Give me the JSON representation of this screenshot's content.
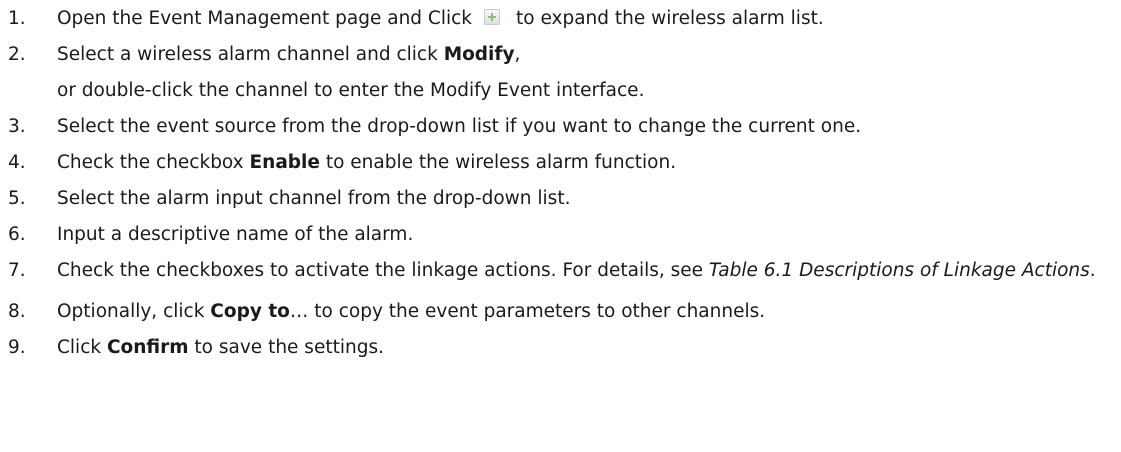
{
  "steps": [
    {
      "number": "1.",
      "before_icon": "Open the Event Management page and Click",
      "icon": "plus-icon",
      "after_icon": "to expand the wireless alarm list."
    },
    {
      "number": "2.",
      "line1_a": "Select a wireless alarm channel and click ",
      "line1_bold": "Modify",
      "line1_b": ",",
      "line2": "or double-click the channel to enter the Modify Event interface."
    },
    {
      "number": "3.",
      "text": "Select the event source from the drop-down list if you want to change the current one."
    },
    {
      "number": "4.",
      "a": "Check the checkbox ",
      "bold": "Enable",
      "b": " to enable the wireless alarm function."
    },
    {
      "number": "5.",
      "text": "Select the alarm input channel from the drop-down list."
    },
    {
      "number": "6.",
      "text": "Input a descriptive name of the alarm."
    },
    {
      "number": "7.",
      "a": "Check the checkboxes to activate the linkage actions. For details, see ",
      "italic": "Table 6.1 Descriptions of Linkage Actions",
      "b": "."
    },
    {
      "number": "8.",
      "a": "Optionally, click ",
      "bold": "Copy to",
      "b": "… to copy the event parameters to other channels."
    },
    {
      "number": "9.",
      "a": "Click ",
      "bold": "Confirm",
      "b": " to save the settings."
    }
  ]
}
